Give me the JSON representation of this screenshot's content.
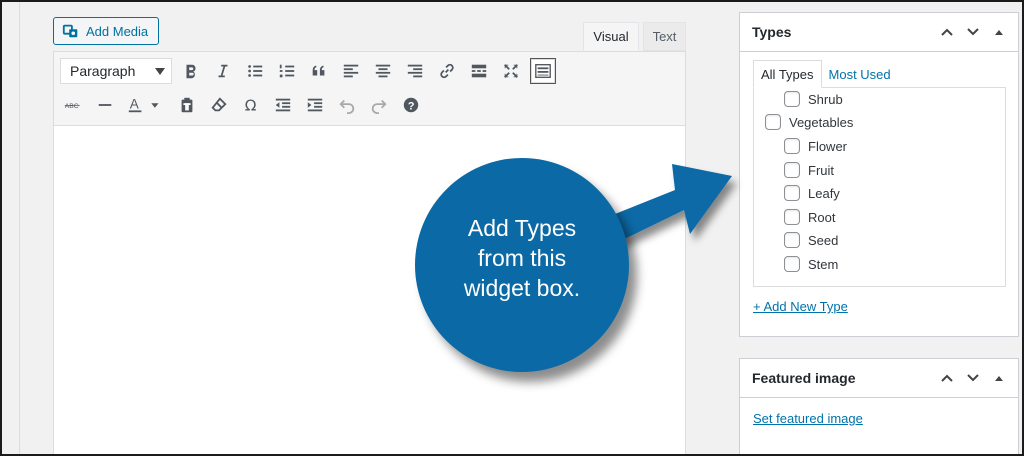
{
  "editor": {
    "add_media_label": "Add Media",
    "tabs": [
      {
        "label": "Visual"
      },
      {
        "label": "Text"
      }
    ],
    "format_select": "Paragraph",
    "toolbar_row1": [
      "bold-icon",
      "italic-icon",
      "bulleted-list-icon",
      "numbered-list-icon",
      "blockquote-icon",
      "align-left-icon",
      "align-center-icon",
      "align-right-icon",
      "link-icon",
      "read-more-icon",
      "fullscreen-icon",
      "toolbar-toggle-icon"
    ],
    "toolbar_row2": [
      "strikethrough-icon",
      "horizontal-line-icon",
      "text-color-icon",
      "paste-text-icon",
      "clear-formatting-icon",
      "special-character-icon",
      "outdent-icon",
      "indent-icon",
      "undo-icon",
      "redo-icon",
      "help-icon"
    ]
  },
  "types_box": {
    "title": "Types",
    "tabs": [
      {
        "label": "All Types"
      },
      {
        "label": "Most Used"
      }
    ],
    "items": [
      {
        "label": "Shrub",
        "level": 1
      },
      {
        "label": "Vegetables",
        "level": 0
      },
      {
        "label": "Flower",
        "level": 1
      },
      {
        "label": "Fruit",
        "level": 1
      },
      {
        "label": "Leafy",
        "level": 1
      },
      {
        "label": "Root",
        "level": 1
      },
      {
        "label": "Seed",
        "level": 1
      },
      {
        "label": "Stem",
        "level": 1
      }
    ],
    "add_new_label": "+ Add New Type"
  },
  "featured_box": {
    "title": "Featured image",
    "set_label": "Set featured image"
  },
  "callout": {
    "text_line1": "Add Types",
    "text_line2": "from this",
    "text_line3": "widget box.",
    "color": "#0b6aa6"
  }
}
